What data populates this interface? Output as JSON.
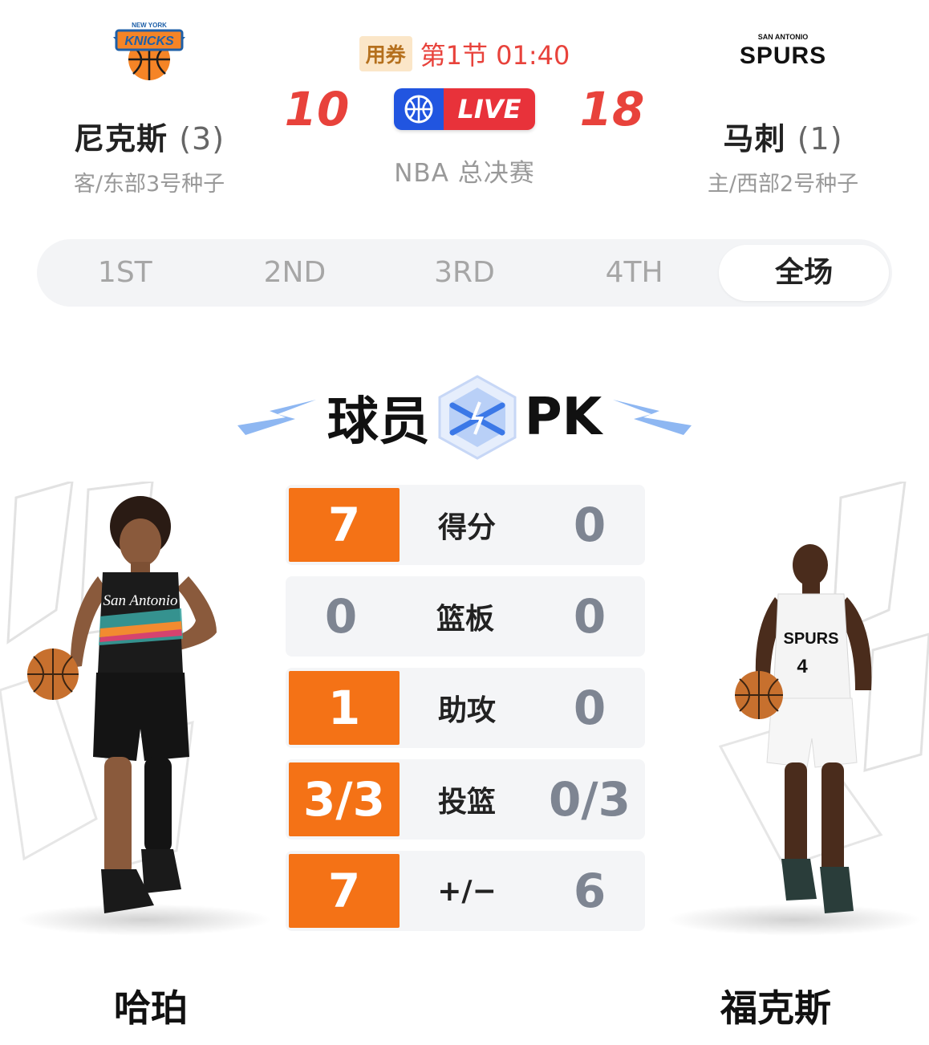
{
  "header": {
    "away": {
      "name": "尼克斯",
      "record": "(3)",
      "seed": "客/东部3号种子",
      "logo_icon": "knicks-logo-icon",
      "score": "10"
    },
    "home": {
      "name": "马刺",
      "record": "(1)",
      "seed": "主/西部2号种子",
      "logo_icon": "spurs-logo-icon",
      "score": "18"
    },
    "coupon": "用券",
    "period_clock": "第1节 01:40",
    "live": "LIVE",
    "competition": "NBA 总决赛"
  },
  "tabs": [
    {
      "label": "1ST",
      "active": false
    },
    {
      "label": "2ND",
      "active": false
    },
    {
      "label": "3RD",
      "active": false
    },
    {
      "label": "4TH",
      "active": false
    },
    {
      "label": "全场",
      "active": true
    }
  ],
  "pk": {
    "title_left": "球员",
    "title_right": "PK"
  },
  "stats": [
    {
      "label": "得分",
      "left": "7",
      "right": "0",
      "left_wins": true
    },
    {
      "label": "篮板",
      "left": "0",
      "right": "0",
      "left_wins": false
    },
    {
      "label": "助攻",
      "left": "1",
      "right": "0",
      "left_wins": true
    },
    {
      "label": "投篮",
      "left": "3/3",
      "right": "0/3",
      "left_wins": true
    },
    {
      "label": "+/−",
      "left": "7",
      "right": "6",
      "left_wins": true
    }
  ],
  "players": {
    "left": {
      "name": "哈珀",
      "jersey_text": "San Antonio"
    },
    "right": {
      "name": "福克斯",
      "jersey_text": "SPURS",
      "number": "4"
    }
  },
  "colors": {
    "accent_red": "#e8423b",
    "win_orange": "#f47216",
    "live_blue": "#2155e0"
  }
}
